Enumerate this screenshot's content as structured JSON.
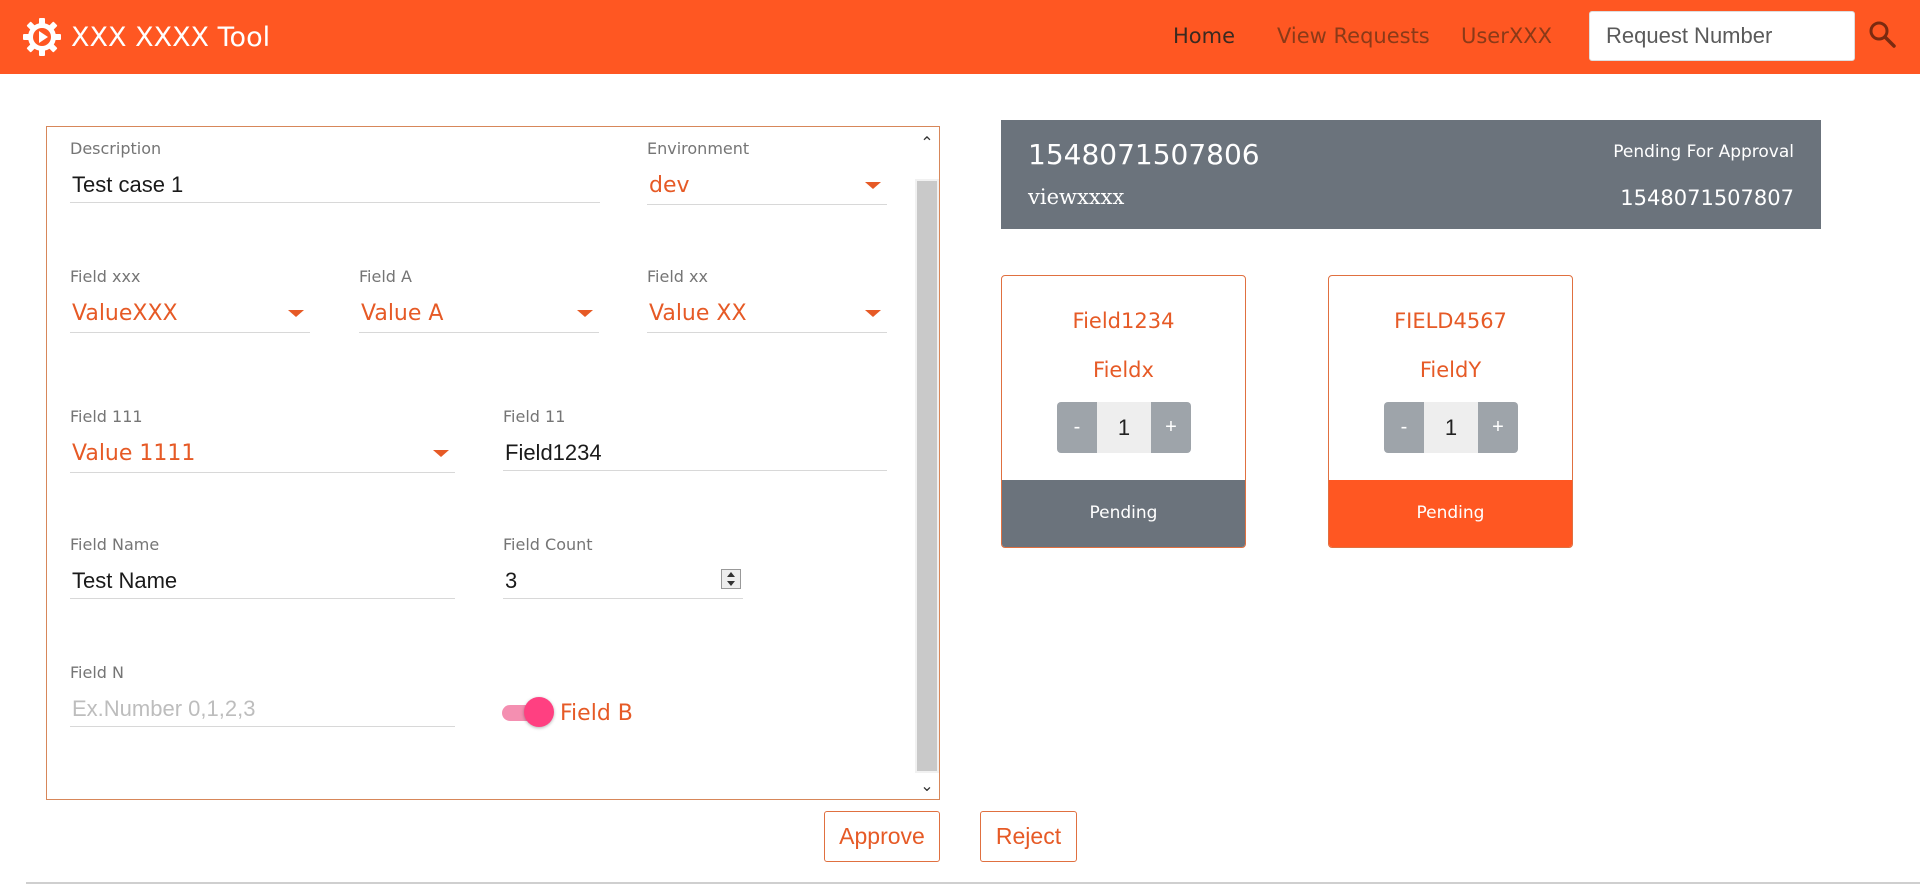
{
  "header": {
    "title": "XXX XXXX Tool",
    "logo_icon": "gear-play-icon",
    "nav": {
      "home": "Home",
      "view_requests": "View Requests",
      "user": "UserXXX"
    },
    "search": {
      "placeholder": "Request Number",
      "icon": "search-icon"
    },
    "color": "#ff5722"
  },
  "form": {
    "description": {
      "label": "Description",
      "value": "Test case 1"
    },
    "environment": {
      "label": "Environment",
      "value": "dev"
    },
    "field_xxx": {
      "label": "Field xxx",
      "value": "ValueXXX"
    },
    "field_a": {
      "label": "Field A",
      "value": "Value A"
    },
    "field_xx": {
      "label": "Field xx",
      "value": "Value XX"
    },
    "field_111": {
      "label": "Field 111",
      "value": "Value 1111"
    },
    "field_11": {
      "label": "Field 11",
      "value": "Field1234"
    },
    "field_name": {
      "label": "Field Name",
      "value": "Test Name"
    },
    "field_count": {
      "label": "Field Count",
      "value": "3"
    },
    "field_n": {
      "label": "Field N",
      "placeholder": "Ex.Number 0,1,2,3",
      "value": ""
    },
    "field_b": {
      "label": "Field B",
      "on": true
    }
  },
  "actions": {
    "approve": "Approve",
    "reject": "Reject"
  },
  "summary": {
    "request_id": "1548071507806",
    "user": "viewxxxx",
    "status": "Pending For Approval",
    "number": "1548071507807",
    "color": "#6b737c"
  },
  "cards": [
    {
      "title": "Field1234",
      "subtitle": "Fieldx",
      "minus": "-",
      "quantity": "1",
      "plus": "+",
      "status": "Pending",
      "footer_color": "#6b737c"
    },
    {
      "title": "FIELD4567",
      "subtitle": "FieldY",
      "minus": "-",
      "quantity": "1",
      "plus": "+",
      "status": "Pending",
      "footer_color": "#ff5722"
    }
  ]
}
